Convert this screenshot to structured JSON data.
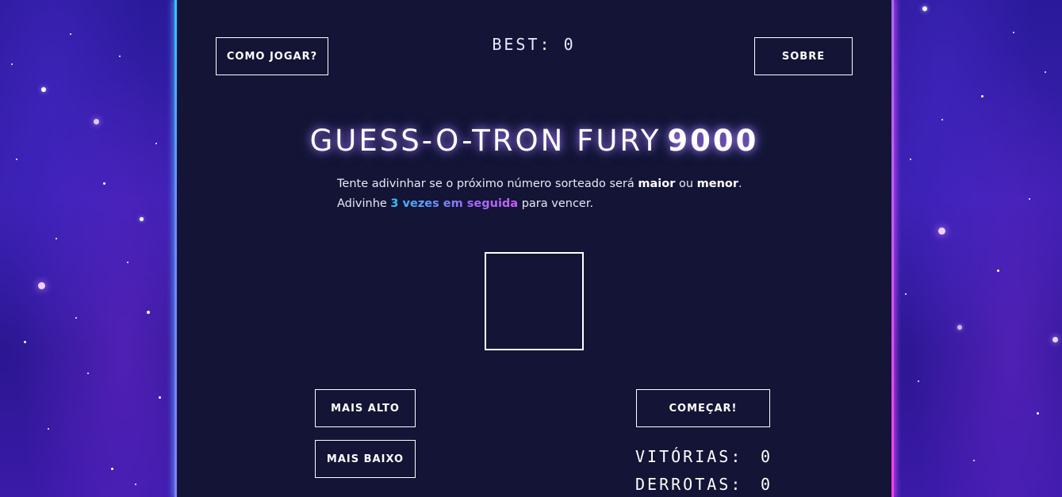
{
  "header": {
    "how_to_play_label": "COMO JOGAR?",
    "about_label": "SOBRE",
    "best_label": "BEST:",
    "best_value": "0"
  },
  "title": {
    "main": "GUESS-O-TRON FURY",
    "number": "9000"
  },
  "intro": {
    "line1_prefix": "Tente adivinhar se o próximo número sorteado será ",
    "line1_bold1": "maior",
    "line1_mid": " ou ",
    "line1_bold2": "menor",
    "line1_suffix": ".",
    "line2_prefix": "Adivinhe ",
    "line2_highlight": "3 vezes em seguida",
    "line2_suffix": " para vencer."
  },
  "number_display": {
    "value": ""
  },
  "controls": {
    "higher_label": "MAIS ALTO",
    "lower_label": "MAIS BAIXO",
    "start_label": "COMEÇAR!"
  },
  "stats": {
    "wins_label": "VITÓRIAS:",
    "wins_value": "0",
    "losses_label": "DERROTAS:",
    "losses_value": "0"
  },
  "colors": {
    "panel_bg": "#141436",
    "space_bg": "#2a1a9a",
    "neon_left": "#2fc7ff",
    "neon_right": "#ff3cf0",
    "highlight_start": "#2fc3ff",
    "highlight_end": "#d05cff"
  }
}
